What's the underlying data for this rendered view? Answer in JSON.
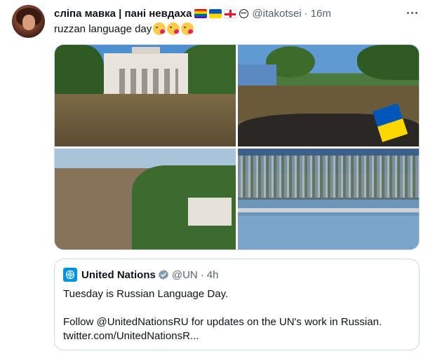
{
  "tweet": {
    "display_name": "сліпа мавка | пані невдаха",
    "name_emojis": [
      "rainbow-flag",
      "ukraine-flag",
      "georgia-flag",
      "no-entry"
    ],
    "handle": "@itakotsei",
    "separator": "·",
    "time": "16m",
    "text": "ruzzan language day",
    "text_emojis": [
      "face-blowing-kiss",
      "face-blowing-kiss",
      "face-blowing-kiss"
    ],
    "media": [
      {
        "label": "flooded-theatre-building"
      },
      {
        "label": "flooded-street-from-vehicle-with-ukraine-flag"
      },
      {
        "label": "aerial-flooded-riverbank-with-house"
      },
      {
        "label": "aerial-destroyed-dam"
      }
    ]
  },
  "quoted_tweet": {
    "display_name": "United Nations",
    "handle": "@UN",
    "separator": "·",
    "time": "4h",
    "line1": "Tuesday is Russian Language Day.",
    "line2": "Follow @UnitedNationsRU for updates on the UN's work in Russian.",
    "line3": "twitter.com/UnitedNationsR..."
  },
  "colors": {
    "text_primary": "#0f1419",
    "text_secondary": "#536471",
    "border": "#cfd9de",
    "un_blue": "#0092e0",
    "verified_gray": "#829aab"
  }
}
